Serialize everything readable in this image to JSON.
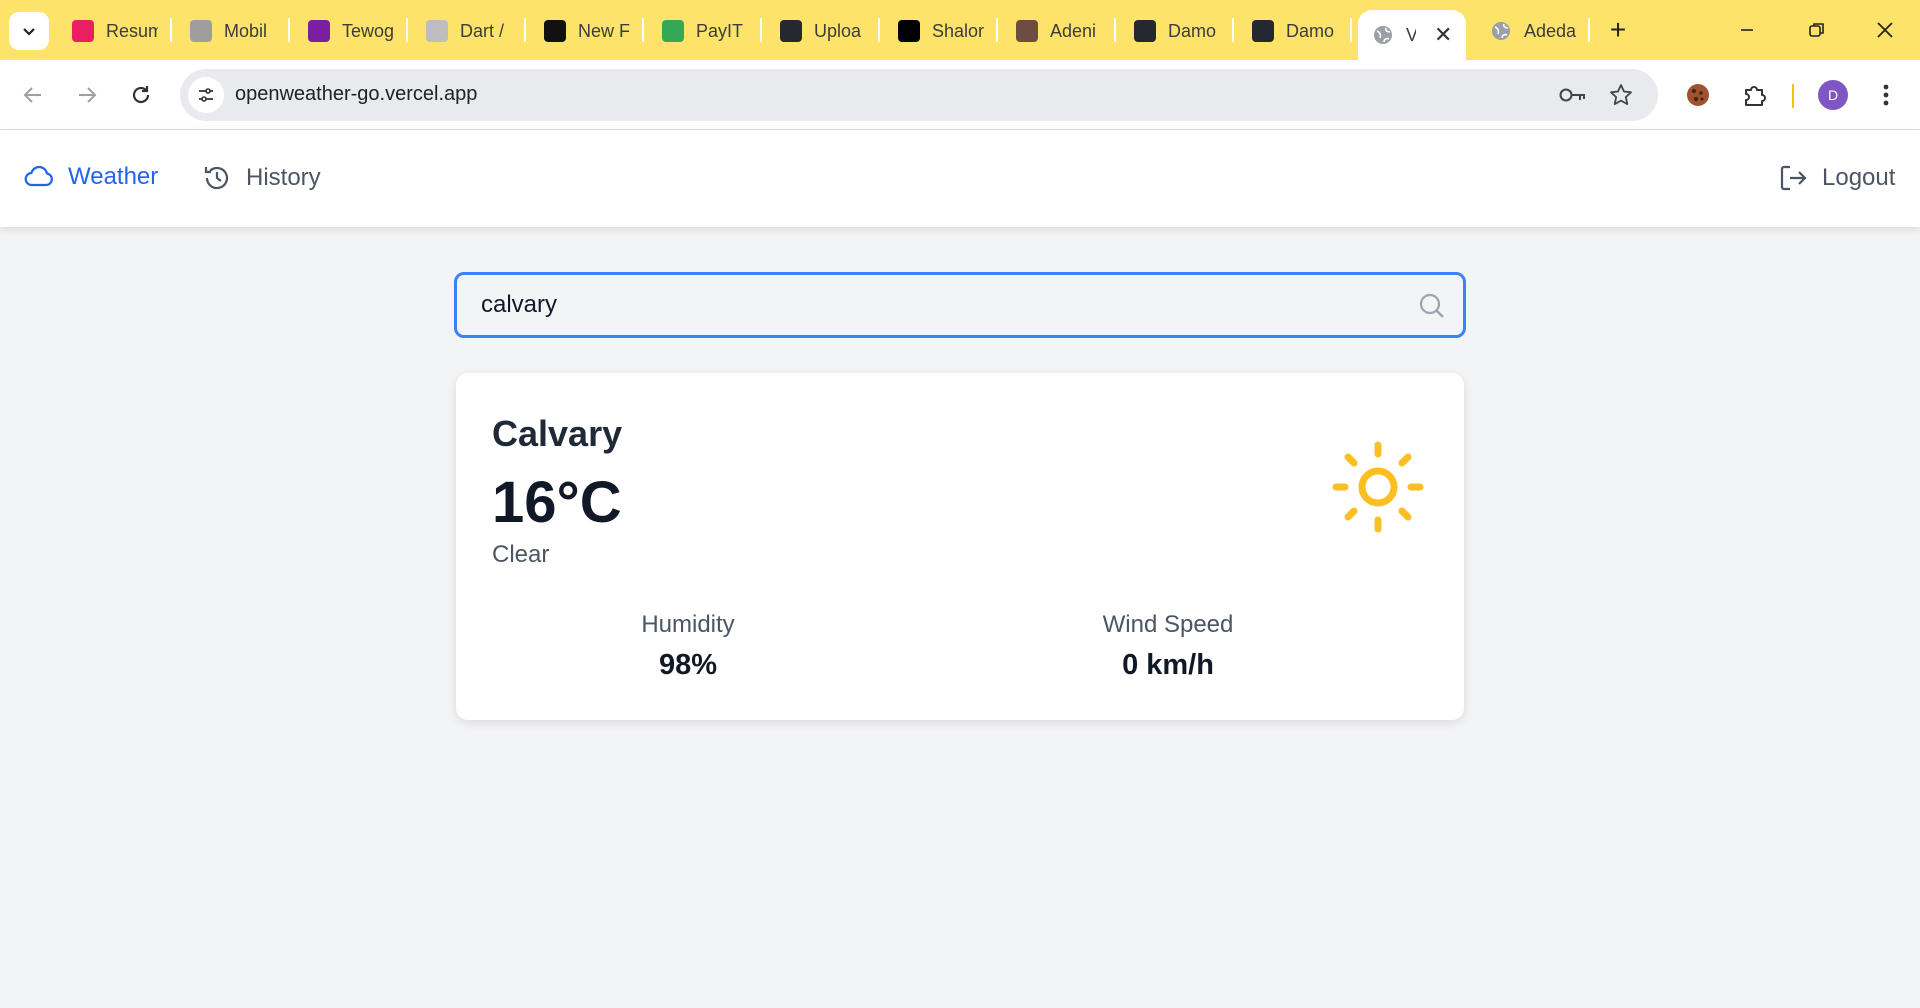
{
  "browser": {
    "tabs": [
      {
        "label": "Resum",
        "icon": "resume-app-icon",
        "color": "#e91e63"
      },
      {
        "label": "Mobil",
        "icon": "openai-icon",
        "color": "#9e9e9e"
      },
      {
        "label": "Tewog",
        "icon": "photo-thumbnail-icon",
        "color": "#7b1fa2"
      },
      {
        "label": "Dart /",
        "icon": "mjm-logo-icon",
        "color": "#bdbdbd"
      },
      {
        "label": "New F",
        "icon": "triangle-logo-icon",
        "color": "#111111"
      },
      {
        "label": "PayIT",
        "icon": "google-play-icon",
        "color": "#34a853"
      },
      {
        "label": "Uploa",
        "icon": "github-icon",
        "color": "#24292f"
      },
      {
        "label": "Shalor",
        "icon": "x-logo-icon",
        "color": "#000000"
      },
      {
        "label": "Adeni",
        "icon": "profile-photo-icon",
        "color": "#6d4c41"
      },
      {
        "label": "Damo",
        "icon": "github-icon",
        "color": "#24292f"
      },
      {
        "label": "Damo",
        "icon": "github-icon",
        "color": "#24292f"
      }
    ],
    "active_tab": {
      "label": "V",
      "icon": "globe-icon"
    },
    "last_tab": {
      "label": "Adeda",
      "icon": "globe-icon"
    },
    "url": "openweather-go.vercel.app",
    "profile_initial": "D"
  },
  "nav": {
    "weather_label": "Weather",
    "history_label": "History",
    "logout_label": "Logout"
  },
  "search": {
    "value": "calvary"
  },
  "weather": {
    "city": "Calvary",
    "temperature": "16°C",
    "condition": "Clear",
    "condition_icon": "sun-icon",
    "humidity_label": "Humidity",
    "humidity_value": "98%",
    "wind_label": "Wind Speed",
    "wind_value": "0 km/h"
  },
  "colors": {
    "tabstrip": "#fde36a",
    "accent": "#2563eb",
    "sun": "#fbbf24"
  }
}
